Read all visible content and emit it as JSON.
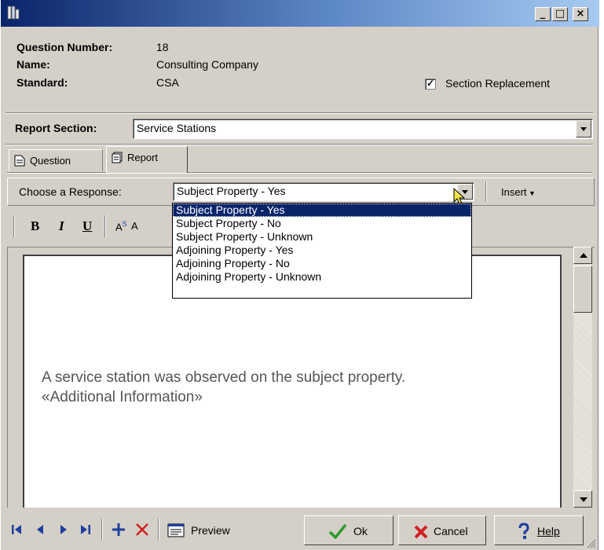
{
  "labels": {
    "question_number": "Question Number:",
    "name": "Name:",
    "standard": "Standard:",
    "report_section": "Report Section:",
    "section_replacement": "Section Replacement"
  },
  "values": {
    "question_number": "18",
    "name": "Consulting Company",
    "standard": "CSA",
    "report_section": "Service Stations",
    "section_replacement_checked": true
  },
  "tabs": [
    {
      "label": "Question",
      "icon": "document-icon"
    },
    {
      "label": "Report",
      "icon": "report-icon"
    }
  ],
  "response": {
    "label": "Choose a Response:",
    "selected": "Subject Property - Yes",
    "insert_label": "Insert",
    "options": [
      "Subject Property - Yes",
      "Subject Property - No",
      "Subject Property - Unknown",
      "Adjoining Property - Yes",
      "Adjoining Property - No",
      "Adjoining Property - Unknown"
    ]
  },
  "format": {
    "bold": "B",
    "italic": "I",
    "underline": "U",
    "superscript": "A",
    "superscript_mark": "S",
    "subscript": "A"
  },
  "editor": {
    "line1": "A service station was observed on the subject property.",
    "line2": "«Additional Information»"
  },
  "buttons": {
    "preview": "Preview",
    "ok": "Ok",
    "cancel": "Cancel",
    "help": "Help"
  },
  "titlebar": {
    "minimize": "_",
    "maximize": "□",
    "close": "×"
  },
  "colors": {
    "selection": "#0a246a",
    "nav_blue": "#1f3f9f",
    "ok_green": "#2e9b2e",
    "cancel_red": "#d02020"
  }
}
